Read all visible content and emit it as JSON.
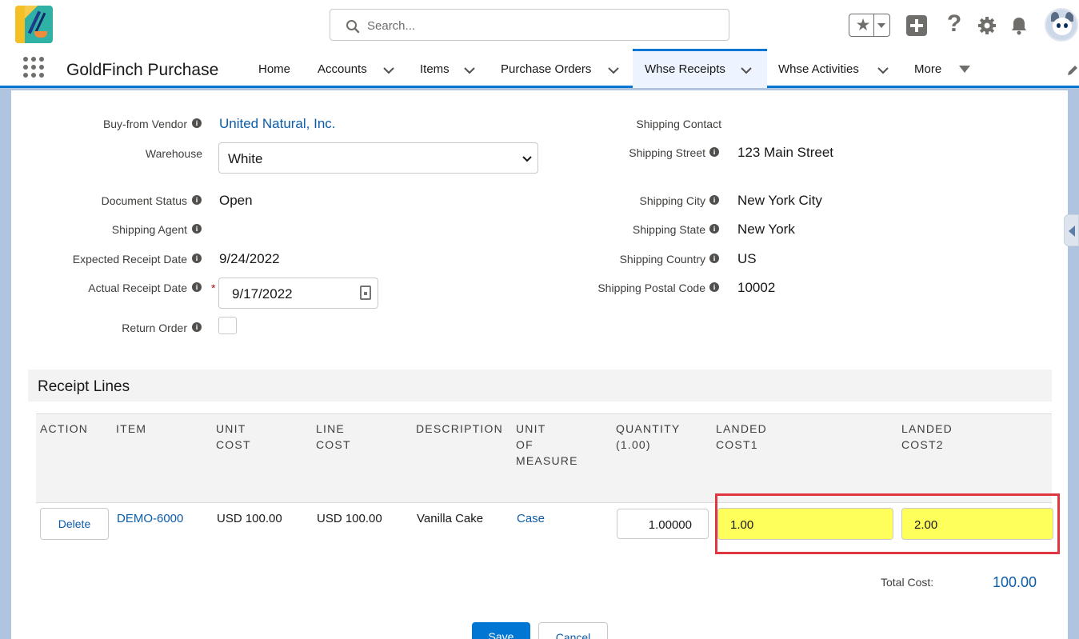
{
  "search": {
    "placeholder": "Search..."
  },
  "app": {
    "name": "GoldFinch Purchase"
  },
  "nav": {
    "items": [
      {
        "label": "Home"
      },
      {
        "label": "Accounts"
      },
      {
        "label": "Items"
      },
      {
        "label": "Purchase Orders"
      },
      {
        "label": "Whse Receipts"
      },
      {
        "label": "Whse Activities"
      },
      {
        "label": "More"
      }
    ]
  },
  "form": {
    "buy_from_vendor": {
      "label": "Buy-from Vendor",
      "value": "United Natural, Inc."
    },
    "warehouse": {
      "label": "Warehouse",
      "value": "White"
    },
    "document_status": {
      "label": "Document Status",
      "value": "Open"
    },
    "shipping_agent": {
      "label": "Shipping Agent",
      "value": ""
    },
    "expected_receipt_date": {
      "label": "Expected Receipt Date",
      "value": "9/24/2022"
    },
    "actual_receipt_date": {
      "label": "Actual Receipt Date",
      "value": "9/17/2022",
      "required": "*"
    },
    "return_order": {
      "label": "Return Order"
    },
    "shipping_contact": {
      "label": "Shipping Contact",
      "value": ""
    },
    "shipping_street": {
      "label": "Shipping Street",
      "value": "123 Main Street"
    },
    "shipping_city": {
      "label": "Shipping City",
      "value": "New York City"
    },
    "shipping_state": {
      "label": "Shipping State",
      "value": "New York"
    },
    "shipping_country": {
      "label": "Shipping Country",
      "value": "US"
    },
    "shipping_postal_code": {
      "label": "Shipping Postal Code",
      "value": "10002"
    }
  },
  "receipt_lines": {
    "title": "Receipt Lines",
    "columns": [
      "ACTION",
      "ITEM",
      "UNIT\nCOST",
      "LINE\nCOST",
      "DESCRIPTION",
      "UNIT\nOF\nMEASURE",
      "QUANTITY\n(1.00)",
      "LANDED\nCOST1",
      "LANDED\nCOST2"
    ],
    "rows": [
      {
        "action": "Delete",
        "item": "DEMO-6000",
        "unit_cost": "USD 100.00",
        "line_cost": "USD 100.00",
        "description": "Vanilla Cake",
        "uom": "Case",
        "quantity": "1.00000",
        "landed_cost1": "1.00",
        "landed_cost2": "2.00"
      }
    ],
    "total_label": "Total Cost:",
    "total_value": "100.00"
  },
  "actions": {
    "save": "Save",
    "cancel": "Cancel"
  },
  "colors": {
    "brand": "#0176d3",
    "highlight_fill": "#ffff5c",
    "highlight_border": "#e0363f"
  }
}
